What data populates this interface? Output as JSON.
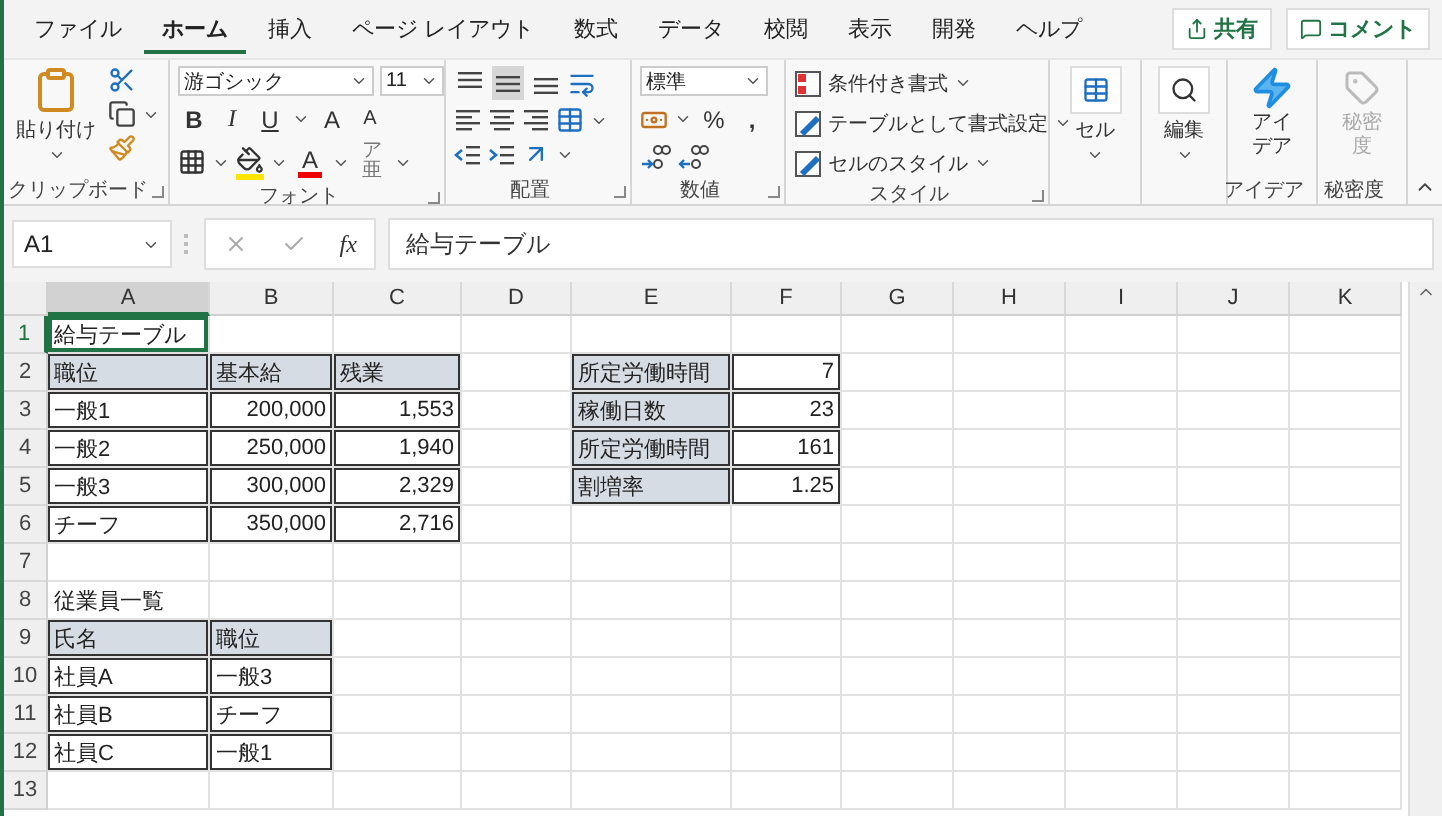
{
  "tabs": [
    {
      "label": "ファイル",
      "selected": false
    },
    {
      "label": "ホーム",
      "selected": true
    },
    {
      "label": "挿入",
      "selected": false
    },
    {
      "label": "ページ レイアウト",
      "selected": false
    },
    {
      "label": "数式",
      "selected": false
    },
    {
      "label": "データ",
      "selected": false
    },
    {
      "label": "校閲",
      "selected": false
    },
    {
      "label": "表示",
      "selected": false
    },
    {
      "label": "開発",
      "selected": false
    },
    {
      "label": "ヘルプ",
      "selected": false
    }
  ],
  "header_buttons": [
    {
      "kind": "share",
      "label": "共有"
    },
    {
      "kind": "comment",
      "label": "コメント"
    }
  ],
  "ribbon": {
    "clipboard": {
      "label": "クリップボード",
      "paste": "貼り付け"
    },
    "font": {
      "label": "フォント",
      "name": "游ゴシック",
      "size": "11",
      "bold": "B",
      "italic": "I",
      "underline": "U",
      "grow": "A",
      "shrink": "A",
      "font_color": "A",
      "phonetic": "ア亜"
    },
    "alignment": {
      "label": "配置",
      "vertical": [
        {
          "kind": "top",
          "selected": false
        },
        {
          "kind": "middle",
          "selected": true
        },
        {
          "kind": "bottom",
          "selected": false
        }
      ]
    },
    "number": {
      "label": "数値",
      "format": "標準",
      "percent": "%",
      "comma": ","
    },
    "styles": {
      "label": "スタイル",
      "items": [
        {
          "kind": "conditional",
          "label": "条件付き書式"
        },
        {
          "kind": "table",
          "label": "テーブルとして書式設定"
        },
        {
          "kind": "cell",
          "label": "セルのスタイル"
        }
      ]
    },
    "cells": {
      "button": "セル"
    },
    "editing": {
      "button": "編集"
    },
    "ideas": {
      "label": "アイデア",
      "button": "アイデア"
    },
    "sensitivity": {
      "label": "秘密度",
      "button": "秘密度",
      "disabled": true
    }
  },
  "formula_bar": {
    "name_box": "A1",
    "fx": "fx",
    "value": "給与テーブル"
  },
  "sheet": {
    "columns": [
      "A",
      "B",
      "C",
      "D",
      "E",
      "F",
      "G",
      "H",
      "I",
      "J",
      "K"
    ],
    "rows": [
      {
        "label": "1",
        "cells": [
          {
            "text": "給与テーブル",
            "kind": "title",
            "selected": true
          }
        ]
      },
      {
        "label": "2",
        "cells": [
          {
            "text": "職位",
            "kind": "header",
            "selected": false
          },
          {
            "text": "基本給",
            "kind": "header",
            "selected": false
          },
          {
            "text": "残業",
            "kind": "header",
            "selected": false
          },
          {
            "kind": "blank",
            "selected": false
          },
          {
            "text": "所定労働時間",
            "kind": "header",
            "selected": false
          },
          {
            "text": "7",
            "kind": "number",
            "selected": false
          }
        ]
      },
      {
        "label": "3",
        "cells": [
          {
            "text": "一般1",
            "kind": "text",
            "selected": false
          },
          {
            "text": "200,000",
            "kind": "number",
            "selected": false
          },
          {
            "text": "1,553",
            "kind": "number",
            "selected": false
          },
          {
            "kind": "blank",
            "selected": false
          },
          {
            "text": "稼働日数",
            "kind": "header",
            "selected": false
          },
          {
            "text": "23",
            "kind": "number",
            "selected": false
          }
        ]
      },
      {
        "label": "4",
        "cells": [
          {
            "text": "一般2",
            "kind": "text",
            "selected": false
          },
          {
            "text": "250,000",
            "kind": "number",
            "selected": false
          },
          {
            "text": "1,940",
            "kind": "number",
            "selected": false
          },
          {
            "kind": "blank",
            "selected": false
          },
          {
            "text": "所定労働時間",
            "kind": "header",
            "selected": false
          },
          {
            "text": "161",
            "kind": "number",
            "selected": false
          }
        ]
      },
      {
        "label": "5",
        "cells": [
          {
            "text": "一般3",
            "kind": "text",
            "selected": false
          },
          {
            "text": "300,000",
            "kind": "number",
            "selected": false
          },
          {
            "text": "2,329",
            "kind": "number",
            "selected": false
          },
          {
            "kind": "blank",
            "selected": false
          },
          {
            "text": "割増率",
            "kind": "header",
            "selected": false
          },
          {
            "text": "1.25",
            "kind": "number",
            "selected": false
          }
        ]
      },
      {
        "label": "6",
        "cells": [
          {
            "text": "チーフ",
            "kind": "text",
            "selected": false
          },
          {
            "text": "350,000",
            "kind": "number",
            "selected": false
          },
          {
            "text": "2,716",
            "kind": "number",
            "selected": false
          }
        ]
      },
      {
        "label": "7",
        "cells": []
      },
      {
        "label": "8",
        "cells": [
          {
            "text": "従業員一覧",
            "kind": "title",
            "selected": false
          }
        ]
      },
      {
        "label": "9",
        "cells": [
          {
            "text": "氏名",
            "kind": "header",
            "selected": false
          },
          {
            "text": "職位",
            "kind": "header",
            "selected": false
          }
        ]
      },
      {
        "label": "10",
        "cells": [
          {
            "text": "社員A",
            "kind": "text",
            "selected": false
          },
          {
            "text": "一般3",
            "kind": "text",
            "selected": false
          }
        ]
      },
      {
        "label": "11",
        "cells": [
          {
            "text": "社員B",
            "kind": "text",
            "selected": false
          },
          {
            "text": "チーフ",
            "kind": "text",
            "selected": false
          }
        ]
      },
      {
        "label": "12",
        "cells": [
          {
            "text": "社員C",
            "kind": "text",
            "selected": false
          },
          {
            "text": "一般1",
            "kind": "text",
            "selected": false
          }
        ]
      },
      {
        "label": "13",
        "cells": []
      }
    ]
  }
}
